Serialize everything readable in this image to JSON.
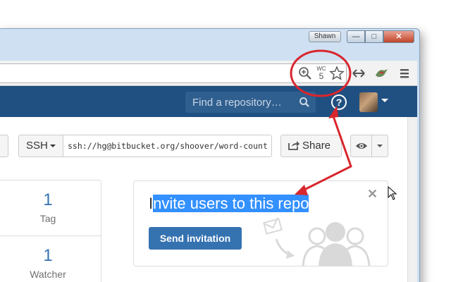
{
  "window": {
    "user_label": "Shawn",
    "min_label": "—",
    "max_label": "□",
    "close_label": "✕"
  },
  "toolbar": {
    "zoom_icon": "zoom-in-icon",
    "wc_label": "WC",
    "wc_count": "5",
    "star_icon": "star-icon",
    "swap_icon": "arrows-icon",
    "extension_icon": "bird-extension-icon",
    "menu_icon": "hamburger-menu-icon"
  },
  "header": {
    "search_placeholder": "Find a repository…",
    "help_label": "?"
  },
  "clone": {
    "protocol": "SSH",
    "url": "ssh://hg@bitbucket.org/shoover/word-count"
  },
  "actions": {
    "share_label": "Share"
  },
  "stats": [
    {
      "number": "1",
      "label": "Tag"
    },
    {
      "number": "1",
      "label": "Watcher"
    }
  ],
  "invite": {
    "title_prefix": "I",
    "title_highlight": "nvite users to this repo",
    "close_label": "✕",
    "button_label": "Send invitation"
  },
  "colors": {
    "header_bg": "#205081",
    "link_blue": "#3572b0",
    "annotation_red": "#d9262d",
    "highlight": "#3390ff"
  }
}
